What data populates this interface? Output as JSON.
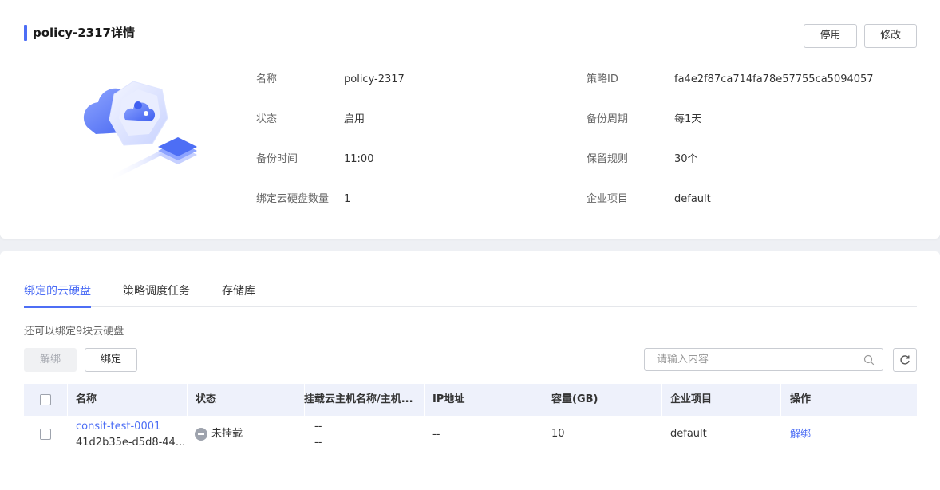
{
  "detail": {
    "title": "policy-2317详情",
    "disable_label": "停用",
    "modify_label": "修改",
    "fields": [
      {
        "label": "名称",
        "value": "policy-2317"
      },
      {
        "label": "策略ID",
        "value": "fa4e2f87ca714fa78e57755ca5094057"
      },
      {
        "label": "状态",
        "value": "启用"
      },
      {
        "label": "备份周期",
        "value": "每1天"
      },
      {
        "label": "备份时间",
        "value": "11:00"
      },
      {
        "label": "保留规则",
        "value": "30个"
      },
      {
        "label": "绑定云硬盘数量",
        "value": "1"
      },
      {
        "label": "企业项目",
        "value": "default"
      }
    ]
  },
  "tabs": [
    {
      "label": "绑定的云硬盘",
      "active": true
    },
    {
      "label": "策略调度任务",
      "active": false
    },
    {
      "label": "存储库",
      "active": false
    }
  ],
  "disks": {
    "hint": "还可以绑定9块云硬盘",
    "unbind_label": "解绑",
    "bind_label": "绑定",
    "search_placeholder": "请输入内容",
    "columns": [
      "名称",
      "状态",
      "挂载云主机名称/主机...",
      "IP地址",
      "容量(GB)",
      "企业项目",
      "操作"
    ],
    "rows": [
      {
        "name": "consit-test-0001",
        "id": "41d2b35e-d5d8-44...",
        "status": "未挂载",
        "host_line1": "--",
        "host_line2": "--",
        "ip": "--",
        "capacity": "10",
        "project": "default",
        "action": "解绑"
      }
    ]
  },
  "colors": {
    "accent": "#4d6ef5",
    "table_header_bg": "#eef1fb",
    "status_unmounted": "#9ea3ad"
  }
}
